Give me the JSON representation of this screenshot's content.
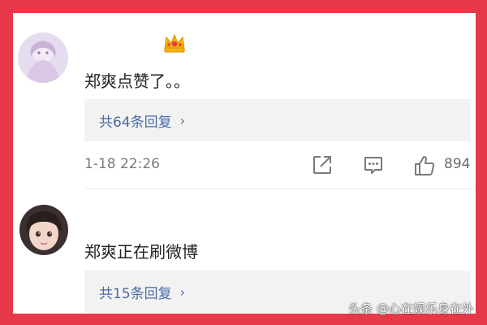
{
  "comments": [
    {
      "text": "郑爽点赞了。。",
      "replies_label": "共64条回复",
      "timestamp": "1-18 22:26",
      "likes": "894"
    },
    {
      "text": "郑爽正在刷微博",
      "replies_label": "共15条回复"
    }
  ],
  "icons": {
    "share": "share-icon",
    "comment": "comment-icon",
    "like": "thumbs-up-icon",
    "badge": "crown-badge-icon",
    "reply_chevron": "›"
  },
  "colors": {
    "frame": "#e8394a",
    "link": "#4a6aa5",
    "reply_bg": "#f2f2f2"
  },
  "watermark": "头条 @心在娱乐身在外"
}
